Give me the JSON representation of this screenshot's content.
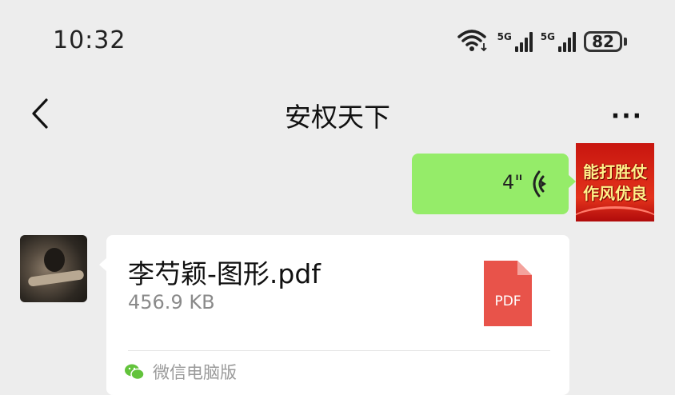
{
  "status_bar": {
    "time": "10:32",
    "network_1": "5G",
    "network_2": "5G",
    "battery": "82"
  },
  "nav": {
    "title": "安权天下",
    "more": "···"
  },
  "messages": {
    "voice": {
      "duration": "4\""
    },
    "my_avatar": {
      "line1": "能打胜仗",
      "line2": "作风优良"
    },
    "file": {
      "name": "李芍颖-图形.pdf",
      "size": "456.9 KB",
      "type_label": "PDF",
      "source": "微信电脑版"
    }
  },
  "colors": {
    "background": "#ededed",
    "bubble_green": "#95ec69",
    "pdf_red": "#e8534a",
    "wechat_green": "#62c33b"
  }
}
